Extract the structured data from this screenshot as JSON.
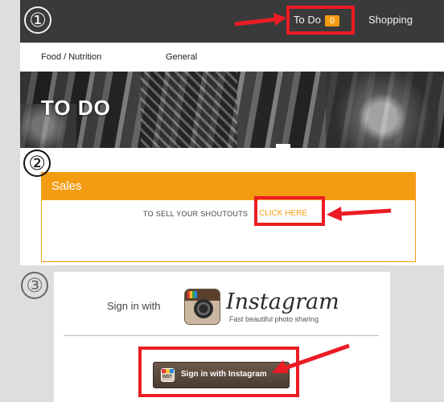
{
  "steps": [
    "①",
    "②",
    "③"
  ],
  "topbar": {
    "todo_label": "To Do",
    "todo_count": "0",
    "shopping_label": "Shopping"
  },
  "subnav": {
    "items": [
      "Food / Nutrition",
      "General"
    ]
  },
  "hero": {
    "title": "TO DO"
  },
  "sales": {
    "title": "Sales",
    "line_text": "TO SELL YOUR SHOUTOUTS",
    "link_text": "CLICK HERE"
  },
  "instagram": {
    "sign_in_text": "Sign in with",
    "brand": "Instagram",
    "tagline": "Fast beautiful photo sharing",
    "button_label": "Sign in with Instagram",
    "mini_icon_text": "INST"
  },
  "colors": {
    "accent_orange": "#f39c12",
    "highlight_red": "#ec1c24",
    "topbar_bg": "#3a3a3a"
  }
}
